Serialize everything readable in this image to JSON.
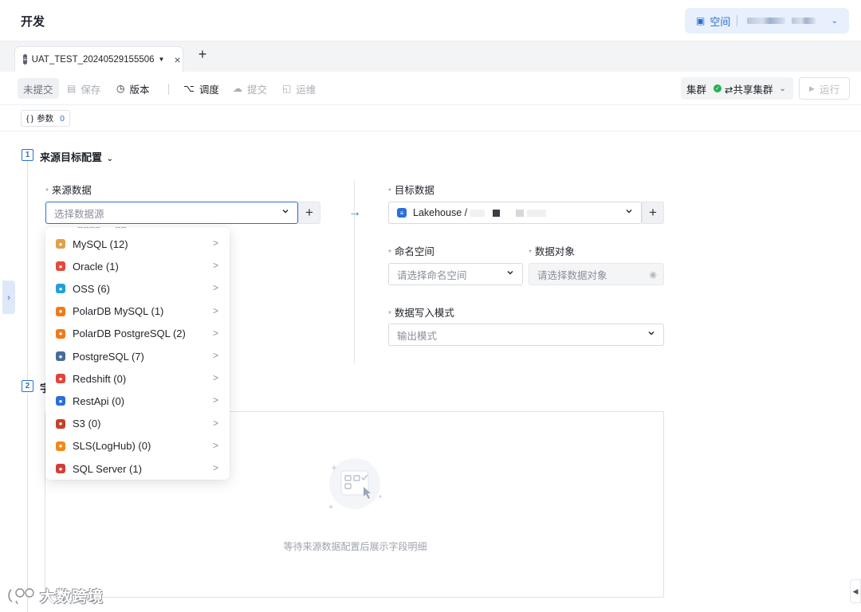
{
  "header": {
    "title": "开发",
    "space_label": "空间"
  },
  "tabs": [
    {
      "label": "UAT_TEST_20240529155506"
    }
  ],
  "toolbar": {
    "status_badge": "未提交",
    "save_label": "保存",
    "version_label": "版本",
    "schedule_label": "调度",
    "submit_label": "提交",
    "ops_label": "运维",
    "cluster_label": "集群",
    "cluster_value": "⇄共享集群",
    "run_label": "运行"
  },
  "params": {
    "label": "参数",
    "count": "0"
  },
  "section1": {
    "number": "1",
    "title": "来源目标配置"
  },
  "section2": {
    "number": "2",
    "title_visible": "字"
  },
  "source": {
    "label": "来源数据",
    "placeholder": "选择数据源"
  },
  "target": {
    "label": "目标数据",
    "value": "Lakehouse / ",
    "namespace_label": "命名空间",
    "namespace_placeholder": "请选择命名空间",
    "object_label": "数据对象",
    "object_placeholder": "请选择数据对象",
    "write_mode_label": "数据写入模式",
    "write_mode_placeholder": "输出模式"
  },
  "datasource_list": [
    {
      "label": "MySQL (12)",
      "icon": "mysql-icon",
      "color": "#e0a04a"
    },
    {
      "label": "Oracle (1)",
      "icon": "oracle-icon",
      "color": "#e34a3a"
    },
    {
      "label": "OSS (6)",
      "icon": "oss-icon",
      "color": "#20a0d8"
    },
    {
      "label": "PolarDB MySQL (1)",
      "icon": "polardb-mysql-icon",
      "color": "#f07a1a"
    },
    {
      "label": "PolarDB PostgreSQL (2)",
      "icon": "polardb-postgresql-icon",
      "color": "#f07a1a"
    },
    {
      "label": "PostgreSQL (7)",
      "icon": "postgresql-icon",
      "color": "#4a6c9b"
    },
    {
      "label": "Redshift (0)",
      "icon": "redshift-icon",
      "color": "#e0443a"
    },
    {
      "label": "RestApi (0)",
      "icon": "restapi-icon",
      "color": "#2b6fd8"
    },
    {
      "label": "S3 (0)",
      "icon": "s3-icon",
      "color": "#c2422a"
    },
    {
      "label": "SLS(LogHub) (0)",
      "icon": "sls-icon",
      "color": "#f08a1a"
    },
    {
      "label": "SQL Server (1)",
      "icon": "sqlserver-icon",
      "color": "#d0403a"
    }
  ],
  "empty_state": {
    "text": "等待来源数据配置后展示字段明细"
  },
  "watermark": {
    "text": "大数跨境"
  },
  "colors": {
    "accent": "#2b6fd8",
    "success": "#22b14c"
  }
}
